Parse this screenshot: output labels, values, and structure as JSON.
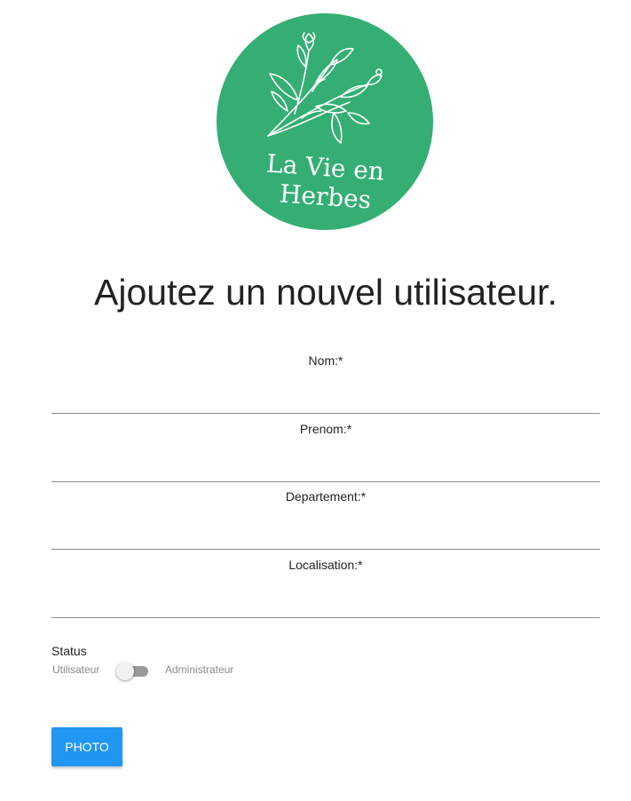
{
  "logo": {
    "line1": "La Vie en",
    "line2": "Herbes",
    "color": "#35ae74"
  },
  "page": {
    "title": "Ajoutez un nouvel utilisateur."
  },
  "form": {
    "fields": [
      {
        "label": "Nom:*",
        "value": "",
        "placeholder": ""
      },
      {
        "label": "Prenom:*",
        "value": "",
        "placeholder": ""
      },
      {
        "label": "Departement:*",
        "value": "",
        "placeholder": ""
      },
      {
        "label": "Localisation:*",
        "value": "",
        "placeholder": ""
      }
    ],
    "status": {
      "label": "Status",
      "off_label": "Utilisateur",
      "on_label": "Administrateur",
      "checked": false
    },
    "photo_button": "PHOTO",
    "button_color": "#2196f3"
  }
}
